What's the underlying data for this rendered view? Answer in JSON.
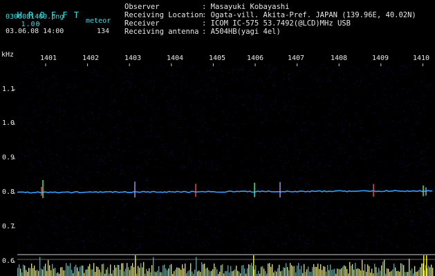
{
  "app": {
    "name": "H R O F F T",
    "version": "1.00",
    "filename": "0306081400.png",
    "mode_label": "meteor",
    "datetime": "03.06.08 14:00",
    "count": "134"
  },
  "info": {
    "labels": [
      "Observer",
      "Receiving Location",
      "Receiver",
      "Receiving antenna"
    ],
    "values": [
      ": Masayuki Kobayashi",
      ": Ogata-vill. Akita-Pref. JAPAN (139.96E, 40.02N)",
      ": ICOM IC-575 53.7492(@LCD)MHz USB",
      ": A504HB(yagi 4el)"
    ]
  },
  "axis": {
    "unit": "kHz",
    "time_ticks": [
      "1401",
      "1402",
      "1403",
      "1404",
      "1405",
      "1406",
      "1407",
      "1408",
      "1409",
      "1410"
    ],
    "freq_ticks": [
      "1.1",
      "1.0",
      "0.9",
      "0.8",
      "0.7",
      "0.6"
    ]
  },
  "colors": {
    "header_text": "#38e0e0",
    "title": "#f0f040",
    "background": "#000000",
    "noise": "#1a1a8a",
    "signal_trace": "#3aa0ff",
    "bars": "#f0f000",
    "bar_fill": "#20c0c0"
  }
}
